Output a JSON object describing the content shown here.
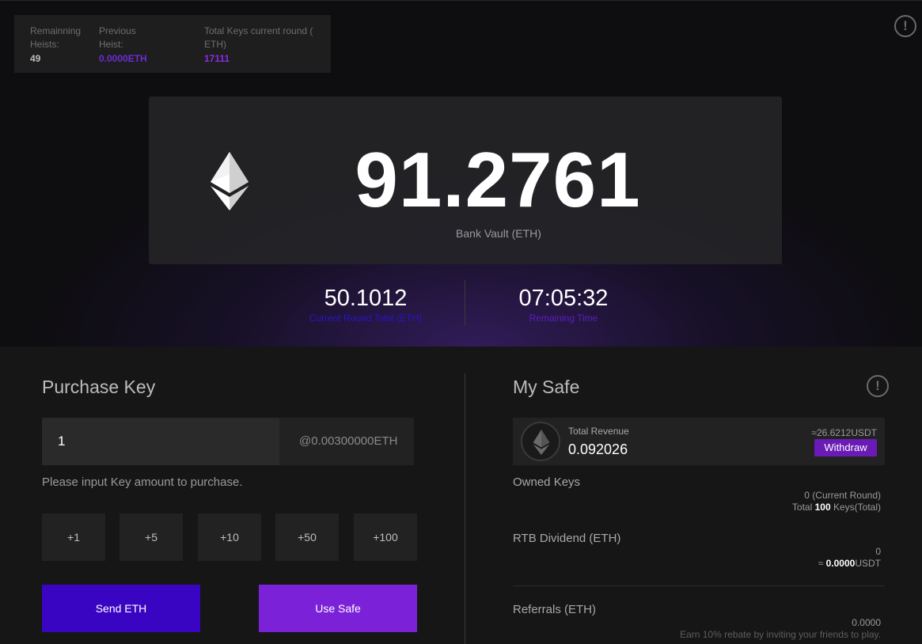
{
  "stats": {
    "remaining_heists_label": "Remainning Heists:",
    "remaining_heists_value": "49",
    "previous_heist_label": "Previous Heist:",
    "previous_heist_value": "0.0000ETH",
    "total_keys_label": "Total Keys current round ( ETH)",
    "total_keys_value": "17111"
  },
  "vault": {
    "amount": "91.2761",
    "label": "Bank Vault (ETH)"
  },
  "round": {
    "total_value": "50.1012",
    "total_label": "Current Round Total (ETH)",
    "time_value": "07:05:32",
    "time_label": "Remaining Time"
  },
  "purchase": {
    "title": "Purchase Key",
    "input_value": "1",
    "price": "@0.00300000ETH",
    "hint": "Please input Key amount to purchase.",
    "increments": [
      "+1",
      "+5",
      "+10",
      "+50",
      "+100"
    ],
    "send_label": "Send ETH",
    "use_safe_label": "Use Safe"
  },
  "safe": {
    "title": "My Safe",
    "revenue_label": "Total Revenue",
    "revenue_value": "0.092026",
    "revenue_usdt": "≈26.6212USDT",
    "withdraw_label": "Withdraw",
    "owned_keys_title": "Owned Keys",
    "owned_current": "0 (Current Round)",
    "owned_total_prefix": "Total ",
    "owned_total_num": "100",
    "owned_total_suffix": " Keys(Total)",
    "dividend_title": "RTB Dividend (ETH)",
    "dividend_value": "0",
    "dividend_usdt_prefix": "≈ ",
    "dividend_usdt_num": "0.0000",
    "dividend_usdt_suffix": "USDT",
    "referrals_title": "Referrals (ETH)",
    "referrals_value": "0.0000",
    "referrals_note": "Earn 10% rebate by inviting your friends to play."
  },
  "colors": {
    "accent_purple": "#7b22d8",
    "accent_blue": "#3a05c2",
    "label_blue": "#2a14c8",
    "label_purple": "#5a1ec0"
  },
  "icons": {
    "info": "exclamation-circle-icon",
    "eth": "ethereum-icon"
  }
}
